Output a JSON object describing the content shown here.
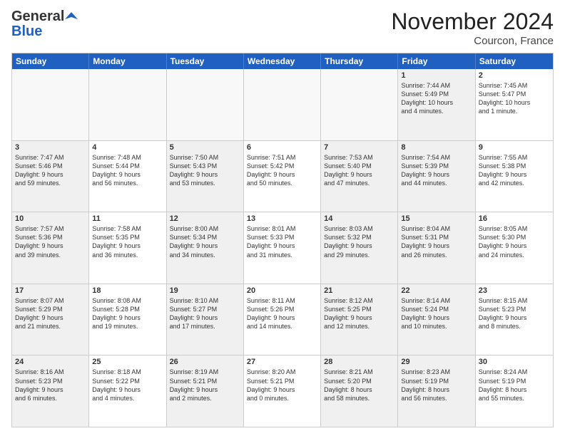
{
  "header": {
    "logo_general": "General",
    "logo_blue": "Blue",
    "month_title": "November 2024",
    "location": "Courcon, France"
  },
  "weekdays": [
    "Sunday",
    "Monday",
    "Tuesday",
    "Wednesday",
    "Thursday",
    "Friday",
    "Saturday"
  ],
  "rows": [
    [
      {
        "day": "",
        "info": "",
        "empty": true
      },
      {
        "day": "",
        "info": "",
        "empty": true
      },
      {
        "day": "",
        "info": "",
        "empty": true
      },
      {
        "day": "",
        "info": "",
        "empty": true
      },
      {
        "day": "",
        "info": "",
        "empty": true
      },
      {
        "day": "1",
        "info": "Sunrise: 7:44 AM\nSunset: 5:49 PM\nDaylight: 10 hours\nand 4 minutes.",
        "shaded": true
      },
      {
        "day": "2",
        "info": "Sunrise: 7:45 AM\nSunset: 5:47 PM\nDaylight: 10 hours\nand 1 minute.",
        "shaded": false
      }
    ],
    [
      {
        "day": "3",
        "info": "Sunrise: 7:47 AM\nSunset: 5:46 PM\nDaylight: 9 hours\nand 59 minutes.",
        "shaded": true
      },
      {
        "day": "4",
        "info": "Sunrise: 7:48 AM\nSunset: 5:44 PM\nDaylight: 9 hours\nand 56 minutes.",
        "shaded": false
      },
      {
        "day": "5",
        "info": "Sunrise: 7:50 AM\nSunset: 5:43 PM\nDaylight: 9 hours\nand 53 minutes.",
        "shaded": true
      },
      {
        "day": "6",
        "info": "Sunrise: 7:51 AM\nSunset: 5:42 PM\nDaylight: 9 hours\nand 50 minutes.",
        "shaded": false
      },
      {
        "day": "7",
        "info": "Sunrise: 7:53 AM\nSunset: 5:40 PM\nDaylight: 9 hours\nand 47 minutes.",
        "shaded": true
      },
      {
        "day": "8",
        "info": "Sunrise: 7:54 AM\nSunset: 5:39 PM\nDaylight: 9 hours\nand 44 minutes.",
        "shaded": true
      },
      {
        "day": "9",
        "info": "Sunrise: 7:55 AM\nSunset: 5:38 PM\nDaylight: 9 hours\nand 42 minutes.",
        "shaded": false
      }
    ],
    [
      {
        "day": "10",
        "info": "Sunrise: 7:57 AM\nSunset: 5:36 PM\nDaylight: 9 hours\nand 39 minutes.",
        "shaded": true
      },
      {
        "day": "11",
        "info": "Sunrise: 7:58 AM\nSunset: 5:35 PM\nDaylight: 9 hours\nand 36 minutes.",
        "shaded": false
      },
      {
        "day": "12",
        "info": "Sunrise: 8:00 AM\nSunset: 5:34 PM\nDaylight: 9 hours\nand 34 minutes.",
        "shaded": true
      },
      {
        "day": "13",
        "info": "Sunrise: 8:01 AM\nSunset: 5:33 PM\nDaylight: 9 hours\nand 31 minutes.",
        "shaded": false
      },
      {
        "day": "14",
        "info": "Sunrise: 8:03 AM\nSunset: 5:32 PM\nDaylight: 9 hours\nand 29 minutes.",
        "shaded": true
      },
      {
        "day": "15",
        "info": "Sunrise: 8:04 AM\nSunset: 5:31 PM\nDaylight: 9 hours\nand 26 minutes.",
        "shaded": true
      },
      {
        "day": "16",
        "info": "Sunrise: 8:05 AM\nSunset: 5:30 PM\nDaylight: 9 hours\nand 24 minutes.",
        "shaded": false
      }
    ],
    [
      {
        "day": "17",
        "info": "Sunrise: 8:07 AM\nSunset: 5:29 PM\nDaylight: 9 hours\nand 21 minutes.",
        "shaded": true
      },
      {
        "day": "18",
        "info": "Sunrise: 8:08 AM\nSunset: 5:28 PM\nDaylight: 9 hours\nand 19 minutes.",
        "shaded": false
      },
      {
        "day": "19",
        "info": "Sunrise: 8:10 AM\nSunset: 5:27 PM\nDaylight: 9 hours\nand 17 minutes.",
        "shaded": true
      },
      {
        "day": "20",
        "info": "Sunrise: 8:11 AM\nSunset: 5:26 PM\nDaylight: 9 hours\nand 14 minutes.",
        "shaded": false
      },
      {
        "day": "21",
        "info": "Sunrise: 8:12 AM\nSunset: 5:25 PM\nDaylight: 9 hours\nand 12 minutes.",
        "shaded": true
      },
      {
        "day": "22",
        "info": "Sunrise: 8:14 AM\nSunset: 5:24 PM\nDaylight: 9 hours\nand 10 minutes.",
        "shaded": true
      },
      {
        "day": "23",
        "info": "Sunrise: 8:15 AM\nSunset: 5:23 PM\nDaylight: 9 hours\nand 8 minutes.",
        "shaded": false
      }
    ],
    [
      {
        "day": "24",
        "info": "Sunrise: 8:16 AM\nSunset: 5:23 PM\nDaylight: 9 hours\nand 6 minutes.",
        "shaded": true
      },
      {
        "day": "25",
        "info": "Sunrise: 8:18 AM\nSunset: 5:22 PM\nDaylight: 9 hours\nand 4 minutes.",
        "shaded": false
      },
      {
        "day": "26",
        "info": "Sunrise: 8:19 AM\nSunset: 5:21 PM\nDaylight: 9 hours\nand 2 minutes.",
        "shaded": true
      },
      {
        "day": "27",
        "info": "Sunrise: 8:20 AM\nSunset: 5:21 PM\nDaylight: 9 hours\nand 0 minutes.",
        "shaded": false
      },
      {
        "day": "28",
        "info": "Sunrise: 8:21 AM\nSunset: 5:20 PM\nDaylight: 8 hours\nand 58 minutes.",
        "shaded": true
      },
      {
        "day": "29",
        "info": "Sunrise: 8:23 AM\nSunset: 5:19 PM\nDaylight: 8 hours\nand 56 minutes.",
        "shaded": true
      },
      {
        "day": "30",
        "info": "Sunrise: 8:24 AM\nSunset: 5:19 PM\nDaylight: 8 hours\nand 55 minutes.",
        "shaded": false
      }
    ]
  ]
}
